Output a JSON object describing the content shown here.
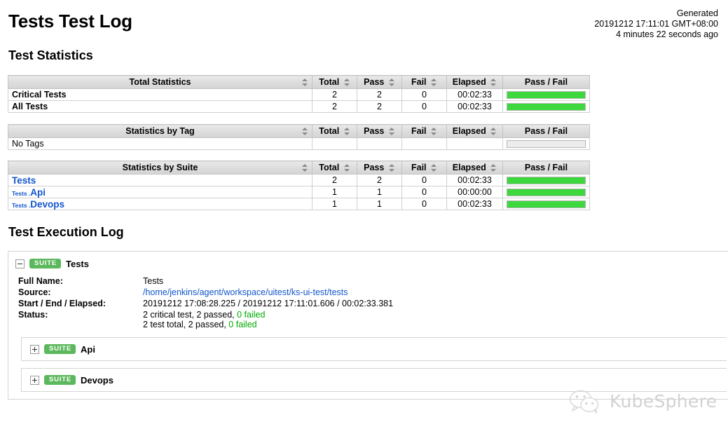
{
  "header": {
    "title": "Tests Test Log",
    "generated_label": "Generated",
    "generated_time": "20191212 17:11:01 GMT+08:00",
    "generated_ago": "4 minutes 22 seconds ago"
  },
  "sections": {
    "statistics_title": "Test Statistics",
    "execution_log_title": "Test Execution Log"
  },
  "tables": {
    "columns": {
      "total": "Total",
      "pass": "Pass",
      "fail": "Fail",
      "elapsed": "Elapsed",
      "graph": "Pass / Fail"
    },
    "total_statistics": {
      "name_header": "Total Statistics",
      "rows": [
        {
          "label": "Critical Tests",
          "total": "2",
          "pass": "2",
          "fail": "0",
          "elapsed": "00:02:33",
          "pass_pct": 100
        },
        {
          "label": "All Tests",
          "total": "2",
          "pass": "2",
          "fail": "0",
          "elapsed": "00:02:33",
          "pass_pct": 100
        }
      ]
    },
    "tag_statistics": {
      "name_header": "Statistics by Tag",
      "rows": [
        {
          "label": "No Tags",
          "total": "",
          "pass": "",
          "fail": "",
          "elapsed": "",
          "pass_pct": 0
        }
      ]
    },
    "suite_statistics": {
      "name_header": "Statistics by Suite",
      "rows": [
        {
          "parent": "",
          "leaf": "Tests",
          "total": "2",
          "pass": "2",
          "fail": "0",
          "elapsed": "00:02:33",
          "pass_pct": 100
        },
        {
          "parent": "Tests .",
          "leaf": "Api",
          "total": "1",
          "pass": "1",
          "fail": "0",
          "elapsed": "00:00:00",
          "pass_pct": 100
        },
        {
          "parent": "Tests .",
          "leaf": "Devops",
          "total": "1",
          "pass": "1",
          "fail": "0",
          "elapsed": "00:02:33",
          "pass_pct": 100
        }
      ]
    }
  },
  "log": {
    "root_suite": {
      "toggle": "−",
      "badge": "SUITE",
      "name": "Tests",
      "fields": {
        "full_name_label": "Full Name:",
        "full_name_value": "Tests",
        "source_label": "Source:",
        "source_value": "/home/jenkins/agent/workspace/uitest/ks-ui-test/tests",
        "times_label": "Start / End / Elapsed:",
        "times_value": "20191212 17:08:28.225 / 20191212 17:11:01.606 / 00:02:33.381",
        "status_label": "Status:",
        "status_line1_pre": "2 critical test, 2 passed, ",
        "status_line1_failed": "0 failed",
        "status_line2_pre": "2 test total, 2 passed, ",
        "status_line2_failed": "0 failed"
      }
    },
    "child_suites": [
      {
        "toggle": "+",
        "badge": "SUITE",
        "name": "Api"
      },
      {
        "toggle": "+",
        "badge": "SUITE",
        "name": "Devops"
      }
    ]
  },
  "footer": {
    "brand": "KubeSphere"
  },
  "colors": {
    "pass_green": "#3dd83d",
    "badge_green": "#5cb85c",
    "link_blue": "#1155cc",
    "pass_text_green": "#00aa00"
  }
}
